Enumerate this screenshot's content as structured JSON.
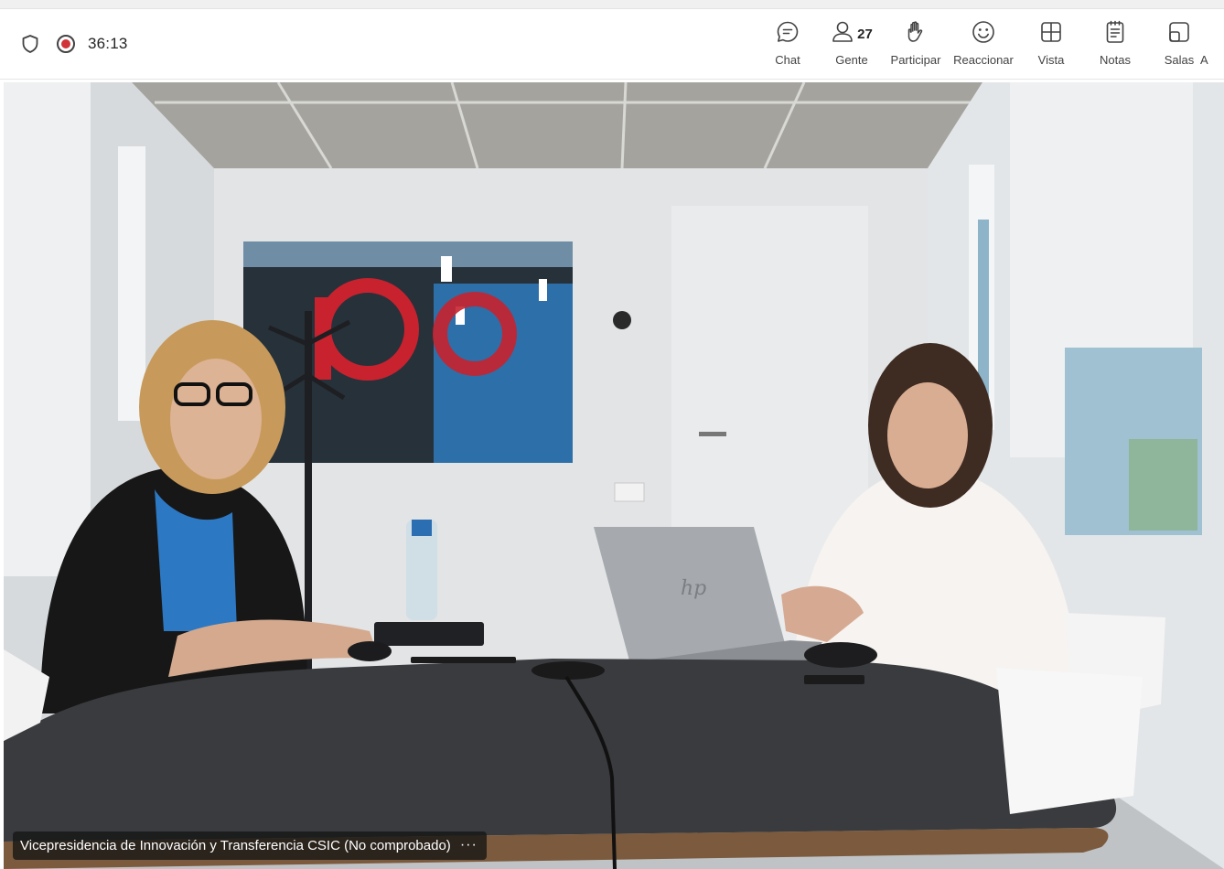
{
  "meeting": {
    "timer": "36:13",
    "recording": true,
    "accent_record": "#d13438"
  },
  "toolbar": {
    "items": [
      {
        "label": "Chat",
        "icon": "chat-icon"
      },
      {
        "label": "Gente",
        "icon": "people-icon",
        "count": "27"
      },
      {
        "label": "Participar",
        "icon": "raise-hand-icon"
      },
      {
        "label": "Reaccionar",
        "icon": "react-icon"
      },
      {
        "label": "Vista",
        "icon": "view-icon"
      },
      {
        "label": "Notas",
        "icon": "notes-icon"
      },
      {
        "label": "Salas",
        "icon": "rooms-icon"
      },
      {
        "label": "A",
        "icon": ""
      }
    ]
  },
  "video": {
    "participant_name": "Vicepresidencia de Innovación y Transferencia CSIC (No comprobado)",
    "more_options": "···"
  }
}
